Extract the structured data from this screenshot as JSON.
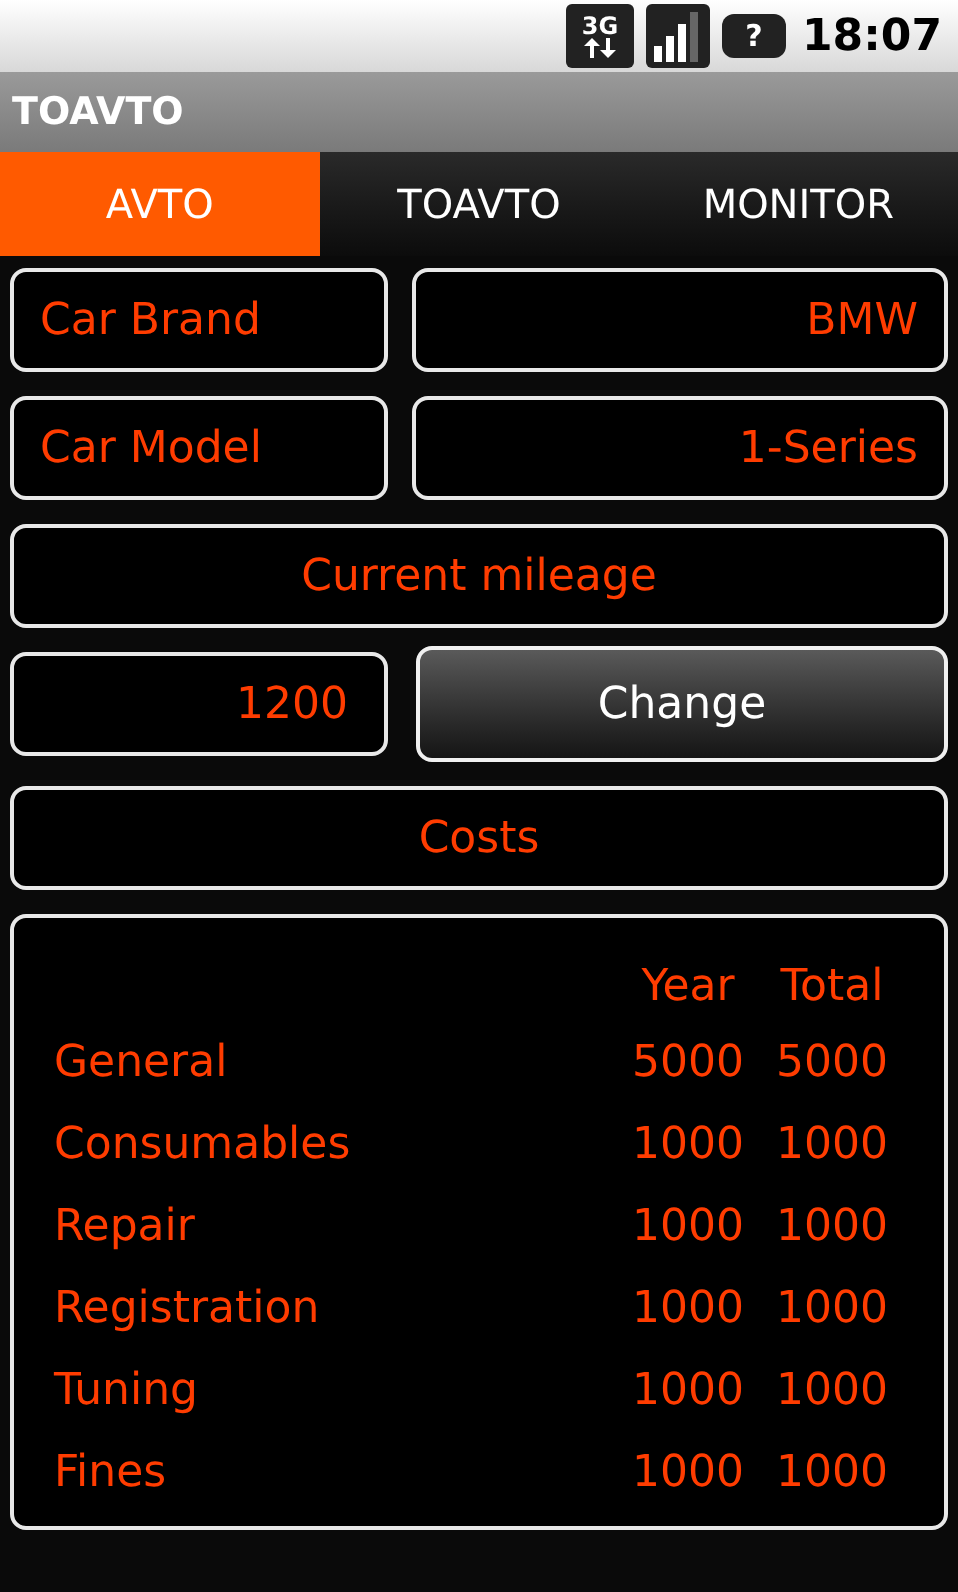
{
  "status_bar": {
    "network": "3G",
    "battery": "?",
    "time": "18:07"
  },
  "window": {
    "title": "TOAVTO"
  },
  "tabs": [
    {
      "label": "AVTO",
      "selected": true
    },
    {
      "label": "TOAVTO",
      "selected": false
    },
    {
      "label": "MONITOR",
      "selected": false
    }
  ],
  "fields": [
    {
      "label": "Car Brand",
      "value": "BMW"
    },
    {
      "label": "Car Model",
      "value": "1-Series"
    }
  ],
  "mileage": {
    "heading": "Current mileage",
    "value": "1200",
    "button": "Change"
  },
  "costs": {
    "heading": "Costs",
    "columns": [
      "Year",
      "Total"
    ],
    "rows": [
      {
        "name": "General",
        "year": "5000",
        "total": "5000"
      },
      {
        "name": "Consumables",
        "year": "1000",
        "total": "1000"
      },
      {
        "name": "Repair",
        "year": "1000",
        "total": "1000"
      },
      {
        "name": "Registration",
        "year": "1000",
        "total": "1000"
      },
      {
        "name": "Tuning",
        "year": "1000",
        "total": "1000"
      },
      {
        "name": "Fines",
        "year": "1000",
        "total": "1000"
      }
    ]
  }
}
